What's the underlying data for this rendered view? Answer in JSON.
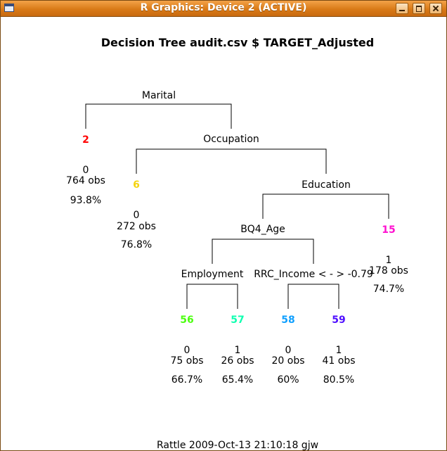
{
  "window": {
    "title": "R Graphics: Device 2 (ACTIVE)"
  },
  "plot": {
    "title": "Decision Tree audit.csv $ TARGET_Adjusted",
    "footer": "Rattle 2009-Oct-13 21:10:18 gjw",
    "splits": {
      "root": "Marital",
      "n3": "Occupation",
      "n7": "Education",
      "n14": "BQ4_Age",
      "n28": "Employment",
      "n29": "RRC_Income < - > -0.79"
    },
    "leaves": [
      {
        "id": "2",
        "color": "#ff0000",
        "class": "0",
        "obs": "764 obs",
        "pct": "93.8%"
      },
      {
        "id": "6",
        "color": "#f5d410",
        "class": "0",
        "obs": "272 obs",
        "pct": "76.8%"
      },
      {
        "id": "15",
        "color": "#ff10d0",
        "class": "1",
        "obs": "178 obs",
        "pct": "74.7%"
      },
      {
        "id": "56",
        "color": "#4cff10",
        "class": "0",
        "obs": "75 obs",
        "pct": "66.7%"
      },
      {
        "id": "57",
        "color": "#10ffb0",
        "class": "1",
        "obs": "26 obs",
        "pct": "65.4%"
      },
      {
        "id": "58",
        "color": "#10a0ff",
        "class": "0",
        "obs": "20 obs",
        "pct": "60%"
      },
      {
        "id": "59",
        "color": "#5010ff",
        "class": "1",
        "obs": "41 obs",
        "pct": "80.5%"
      }
    ]
  }
}
